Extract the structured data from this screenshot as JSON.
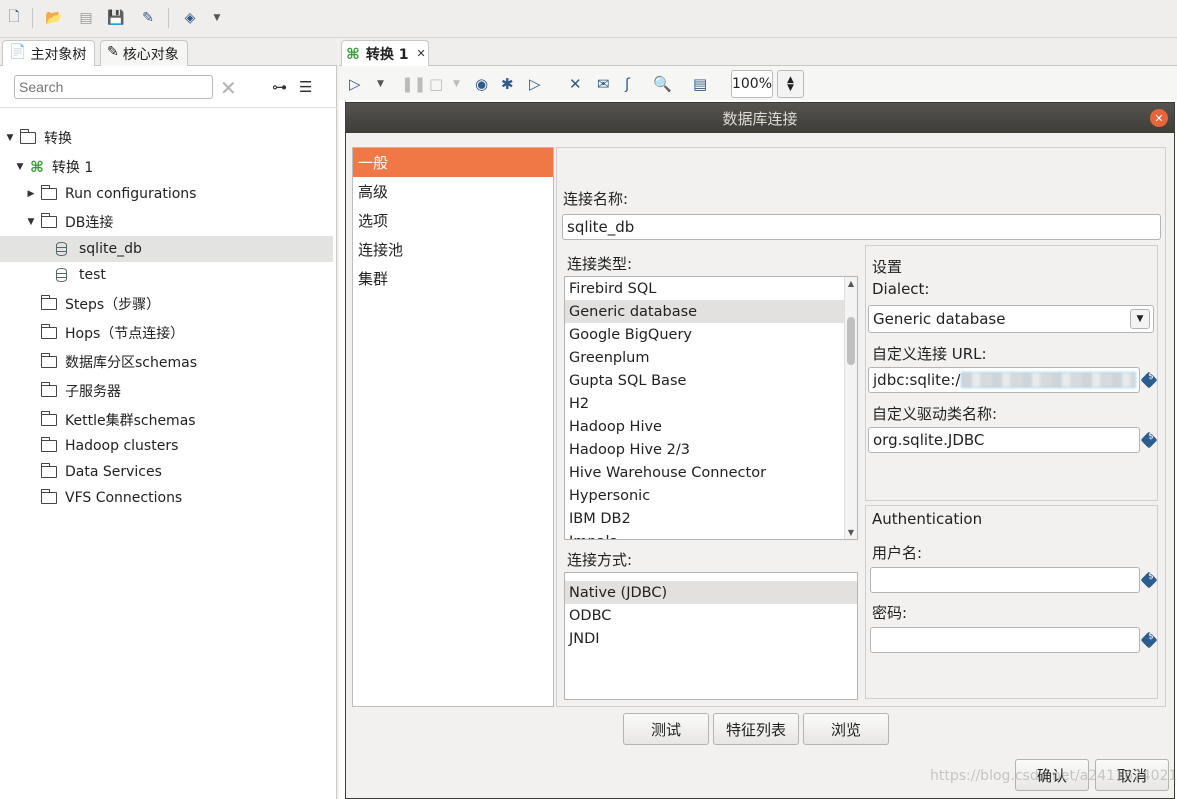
{
  "toolbar": {
    "icons": [
      "new-file-icon",
      "open-file-icon",
      "explore-icon",
      "save-icon",
      "save-as-icon",
      "layers-icon",
      "dropdown-icon"
    ]
  },
  "left": {
    "tabs": [
      {
        "label": "主对象树",
        "icon": "book-icon"
      },
      {
        "label": "核心对象",
        "icon": "pencil-icon"
      }
    ],
    "search_placeholder": "Search",
    "tree": [
      {
        "label": "转换",
        "level": 0,
        "type": "folder",
        "twisty": "▼"
      },
      {
        "label": "转换 1",
        "level": 1,
        "type": "transformation",
        "twisty": "▼"
      },
      {
        "label": "Run configurations",
        "level": 2,
        "type": "folder",
        "twisty": "▶"
      },
      {
        "label": "DB连接",
        "level": 2,
        "type": "folder",
        "twisty": "▼"
      },
      {
        "label": "sqlite_db",
        "level": 3,
        "type": "db",
        "twisty": "",
        "selected": true
      },
      {
        "label": "test",
        "level": 3,
        "type": "db",
        "twisty": ""
      },
      {
        "label": "Steps（步骤）",
        "level": 2,
        "type": "folder",
        "twisty": ""
      },
      {
        "label": "Hops（节点连接）",
        "level": 2,
        "type": "folder",
        "twisty": ""
      },
      {
        "label": "数据库分区schemas",
        "level": 2,
        "type": "folder",
        "twisty": ""
      },
      {
        "label": "子服务器",
        "level": 2,
        "type": "folder",
        "twisty": ""
      },
      {
        "label": "Kettle集群schemas",
        "level": 2,
        "type": "folder",
        "twisty": ""
      },
      {
        "label": "Hadoop clusters",
        "level": 2,
        "type": "folder",
        "twisty": ""
      },
      {
        "label": "Data Services",
        "level": 2,
        "type": "folder",
        "twisty": ""
      },
      {
        "label": "VFS Connections",
        "level": 2,
        "type": "folder",
        "twisty": ""
      }
    ]
  },
  "editor": {
    "tab_label": "转换 1",
    "zoom": "100%"
  },
  "dialog": {
    "title": "数据库连接",
    "nav": [
      "一般",
      "高级",
      "选项",
      "连接池",
      "集群"
    ],
    "connection_name_label": "连接名称:",
    "connection_name": "sqlite_db",
    "connection_type_label": "连接类型:",
    "connection_types": [
      "Firebird SQL",
      "Generic database",
      "Google BigQuery",
      "Greenplum",
      "Gupta SQL Base",
      "H2",
      "Hadoop Hive",
      "Hadoop Hive 2/3",
      "Hive Warehouse Connector",
      "Hypersonic",
      "IBM DB2",
      "Impala"
    ],
    "selected_type": "Generic database",
    "access_label": "连接方式:",
    "access_methods": [
      "Native (JDBC)",
      "ODBC",
      "JNDI"
    ],
    "selected_access": "Native (JDBC)",
    "settings": {
      "heading": "设置",
      "dialect_label": "Dialect:",
      "dialect_value": "Generic database",
      "url_label": "自定义连接 URL:",
      "url_value": "jdbc:sqlite:/",
      "driver_label": "自定义驱动类名称:",
      "driver_value": "org.sqlite.JDBC"
    },
    "auth": {
      "heading": "Authentication",
      "user_label": "用户名:",
      "user_value": "",
      "password_label": "密码:",
      "password_value": ""
    },
    "buttons": {
      "test": "测试",
      "features": "特征列表",
      "explore": "浏览",
      "ok": "确认",
      "cancel": "取消"
    }
  },
  "watermark": "https://blog.csdn.net/a2411624021"
}
